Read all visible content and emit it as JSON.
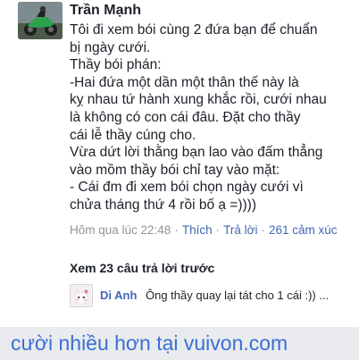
{
  "post": {
    "author": "Trần Mạnh",
    "lines": [
      "Tôi đi xem bói cùng 2 đứa bạn để chuẩn",
      "bị ngày cưới.",
      "Thầy bói phán:",
      "-Hai đứa một dần một thân thế này là",
      "kỵ nhau tứ hành xung khắc rồi, cưới nhau",
      "là không có con cái đâu. Đặt cho thầy",
      "cái lễ thầy cúng cho.",
      "Vừa dứt lời thằng bạn lao vào đấm thẳng",
      "vào mồm thầy bói chỉ tay vào mặt:",
      "- Cái đm đi xem bói chọn ngày  cưới vì",
      "chửa tháng thứ 4 rồi bố ạ =))))"
    ],
    "timestamp": "Hôm qua lúc 22:48",
    "separator": "·",
    "like_label": "Thích",
    "reply_label": "Trả lời",
    "reaction_count": "261",
    "reaction_suffix": "cảm xúc"
  },
  "comments": {
    "more_label": "Xem 23 câu trả lời trước",
    "reply": {
      "name": "Di Anh",
      "text": "Ông thầy quay lại tát cho 1 cái :)) ..."
    }
  },
  "footer": {
    "text": "cười nhiều hơn tại vuivon.com"
  },
  "colors": {
    "link": "#4267b2",
    "meta": "#90949c",
    "footer_text": "#3b6fd4",
    "footer_bg": "#e9ebee"
  }
}
